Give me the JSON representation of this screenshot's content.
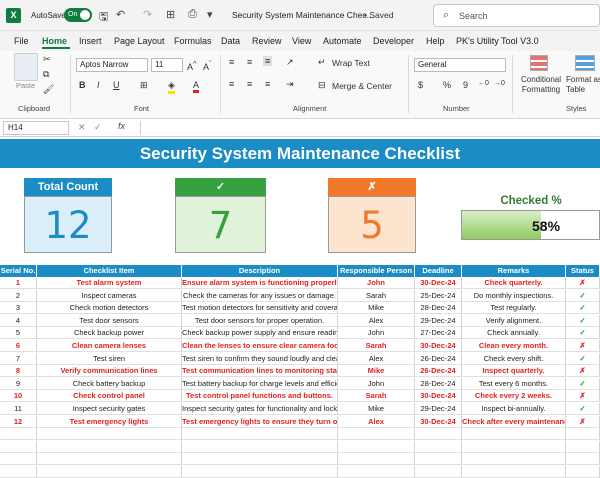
{
  "titlebar": {
    "logo": "X",
    "autosave_label": "AutoSave",
    "toggle_label": "On",
    "doc_title": "Security System Maintenance Chec...",
    "saved": "• Saved",
    "search_placeholder": "Search"
  },
  "menu": [
    "File",
    "Home",
    "Insert",
    "Page Layout",
    "Formulas",
    "Data",
    "Review",
    "View",
    "Automate",
    "Developer",
    "Help",
    "PK's Utility Tool V3.0"
  ],
  "ribbon": {
    "clipboard": {
      "paste": "Paste",
      "label": "Clipboard"
    },
    "font": {
      "name": "Aptos Narrow",
      "size": "11",
      "label": "Font"
    },
    "alignment": {
      "wrap": "Wrap Text",
      "merge": "Merge & Center",
      "label": "Alignment"
    },
    "number": {
      "format": "General",
      "label": "Number"
    },
    "styles": {
      "conditional": "Conditional Formatting",
      "format_as": "Format as Table",
      "label": "Styles"
    }
  },
  "formula_bar": {
    "name_box": "H14",
    "fx": "fx",
    "formula": ""
  },
  "sheet": {
    "title": "Security System Maintenance Checklist",
    "cards": [
      {
        "title": "Total Count",
        "value": "12",
        "color": "#1b8cc5",
        "body_bg": "#dbeefb",
        "value_color": "#1b8cc5"
      },
      {
        "title": "✓",
        "value": "7",
        "color": "#35a140",
        "body_bg": "#e0f2d8",
        "value_color": "#35a140"
      },
      {
        "title": "✗",
        "value": "5",
        "color": "#f07a2a",
        "body_bg": "#fde4cf",
        "value_color": "#f07a2a"
      }
    ],
    "checked_pct": {
      "label": "Checked %",
      "value": "58%",
      "fraction": 0.58
    },
    "columns": [
      "Serial No.",
      "Checklist Item",
      "Description",
      "Responsible Person",
      "Deadline",
      "Remarks",
      "Status"
    ],
    "rows": [
      {
        "no": "1",
        "item": "Test alarm system",
        "desc": "Ensure alarm system is functioning properly.",
        "person": "John",
        "deadline": "30-Dec-24",
        "remarks": "Check quarterly.",
        "status": "✗"
      },
      {
        "no": "2",
        "item": "Inspect cameras",
        "desc": "Check the cameras for any issues or damage.",
        "person": "Sarah",
        "deadline": "25-Dec-24",
        "remarks": "Do monthly inspections.",
        "status": "✓"
      },
      {
        "no": "3",
        "item": "Check motion detectors",
        "desc": "Test motion detectors for sensitivity and coverage.",
        "person": "Mike",
        "deadline": "28-Dec-24",
        "remarks": "Test regularly.",
        "status": "✓"
      },
      {
        "no": "4",
        "item": "Test door sensors",
        "desc": "Test door sensors for proper operation.",
        "person": "Alex",
        "deadline": "29-Dec-24",
        "remarks": "Verify alignment.",
        "status": "✓"
      },
      {
        "no": "5",
        "item": "Check backup power",
        "desc": "Check backup power supply and ensure readiness.",
        "person": "John",
        "deadline": "27-Dec-24",
        "remarks": "Check annually.",
        "status": "✓"
      },
      {
        "no": "6",
        "item": "Clean camera lenses",
        "desc": "Clean the lenses to ensure clear camera footage.",
        "person": "Sarah",
        "deadline": "30-Dec-24",
        "remarks": "Clean every month.",
        "status": "✗"
      },
      {
        "no": "7",
        "item": "Test siren",
        "desc": "Test siren to confirm they sound loudly and clearly.",
        "person": "Alex",
        "deadline": "26-Dec-24",
        "remarks": "Check every shift.",
        "status": "✓"
      },
      {
        "no": "8",
        "item": "Verify communication lines",
        "desc": "Test communication lines to monitoring stations and alarms.",
        "person": "Mike",
        "deadline": "26-Dec-24",
        "remarks": "Inspect quarterly.",
        "status": "✗"
      },
      {
        "no": "9",
        "item": "Check battery backup",
        "desc": "Test battery backup for charge levels and efficiency.",
        "person": "John",
        "deadline": "28-Dec-24",
        "remarks": "Test every 6 months.",
        "status": "✓"
      },
      {
        "no": "10",
        "item": "Check control panel",
        "desc": "Test control panel functions and buttons.",
        "person": "Sarah",
        "deadline": "30-Dec-24",
        "remarks": "Check every 2 weeks.",
        "status": "✗"
      },
      {
        "no": "11",
        "item": "Inspect security gates",
        "desc": "Inspect security gates for functionality and locking mechanisms.",
        "person": "Mike",
        "deadline": "29-Dec-24",
        "remarks": "Inspect bi-annually.",
        "status": "✓"
      },
      {
        "no": "12",
        "item": "Test emergency lights",
        "desc": "Test emergency lights to ensure they turn on properly.",
        "person": "Alex",
        "deadline": "30-Dec-24",
        "remarks": "Check after every maintenance.",
        "status": "✗"
      }
    ]
  }
}
